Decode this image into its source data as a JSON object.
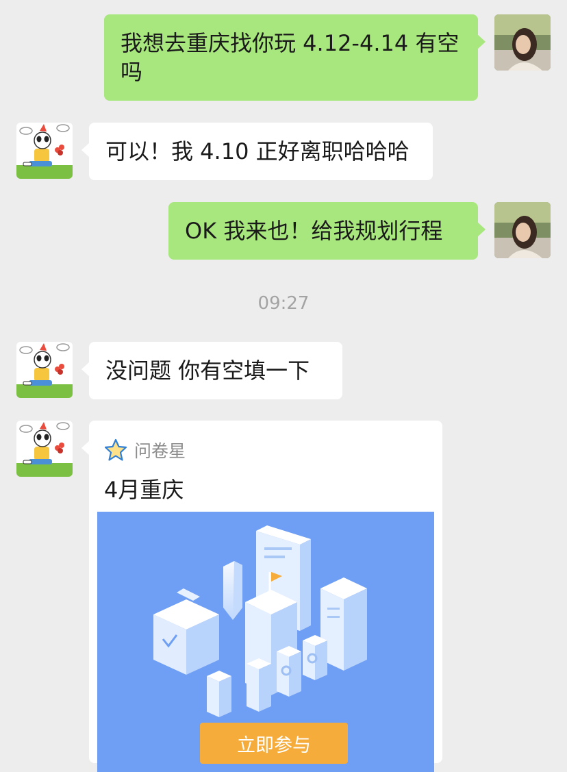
{
  "messages": [
    {
      "sender": "self",
      "text": "我想去重庆找你玩 4.12-4.14 有空吗"
    },
    {
      "sender": "friend",
      "text": "可以！我 4.10 正好离职哈哈哈"
    },
    {
      "sender": "self",
      "text": "OK 我来也！给我规划行程"
    },
    {
      "sender": "friend",
      "text": "没问题 你有空填一下"
    }
  ],
  "timestamp": "09:27",
  "card": {
    "source": "问卷星",
    "source_icon": "star-icon",
    "title": "4月重庆",
    "button_label": "立即参与"
  },
  "colors": {
    "background": "#ededed",
    "self_bubble": "#a8e77d",
    "friend_bubble": "#ffffff",
    "card_image": "#6f9ff5",
    "button": "#f5ac3a"
  }
}
